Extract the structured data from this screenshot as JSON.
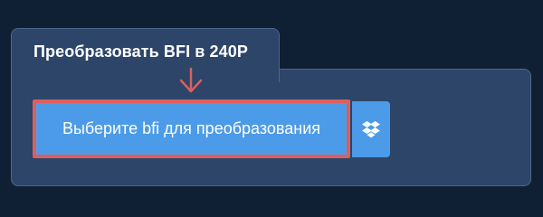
{
  "converter": {
    "tab_title": "Преобразовать BFI в 240P",
    "upload_button_label": "Выберите bfi для преобразования",
    "dropbox_icon": "dropbox-icon",
    "arrow_icon": "arrow-down-icon"
  },
  "colors": {
    "page_background": "#0f2035",
    "panel_background": "#2c4568",
    "button_background": "#4c9be8",
    "highlight_border": "#dc5e5e",
    "text": "#ffffff"
  }
}
